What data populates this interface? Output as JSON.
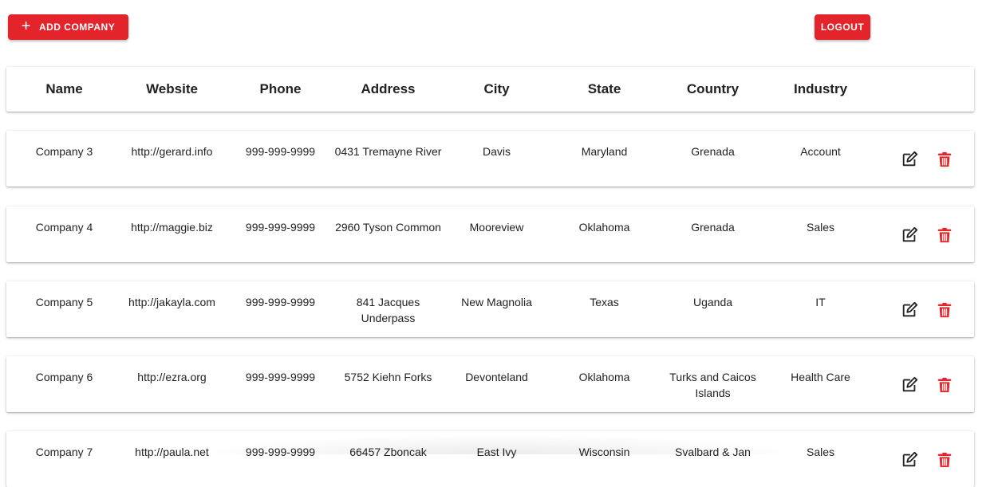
{
  "toolbar": {
    "add_label": "ADD COMPANY",
    "logout_label": "LOGOUT"
  },
  "colors": {
    "accent": "#e3242b"
  },
  "table": {
    "columns": [
      "Name",
      "Website",
      "Phone",
      "Address",
      "City",
      "State",
      "Country",
      "Industry"
    ],
    "rows": [
      [
        "Company 3",
        "http://gerard.info",
        "999-999-9999",
        "0431 Tremayne River",
        "Davis",
        "Maryland",
        "Grenada",
        "Account"
      ],
      [
        "Company 4",
        "http://maggie.biz",
        "999-999-9999",
        "2960 Tyson Common",
        "Mooreview",
        "Oklahoma",
        "Grenada",
        "Sales"
      ],
      [
        "Company 5",
        "http://jakayla.com",
        "999-999-9999",
        "841 Jacques Underpass",
        "New Magnolia",
        "Texas",
        "Uganda",
        "IT"
      ],
      [
        "Company 6",
        "http://ezra.org",
        "999-999-9999",
        "5752 Kiehn Forks",
        "Devonteland",
        "Oklahoma",
        "Turks and Caicos Islands",
        "Health Care"
      ],
      [
        "Company 7",
        "http://paula.net",
        "999-999-9999",
        "66457 Zboncak",
        "East Ivy",
        "Wisconsin",
        "Svalbard & Jan",
        "Sales"
      ]
    ],
    "row_icons": {
      "edit": "edit-icon",
      "delete": "trash-icon"
    }
  }
}
